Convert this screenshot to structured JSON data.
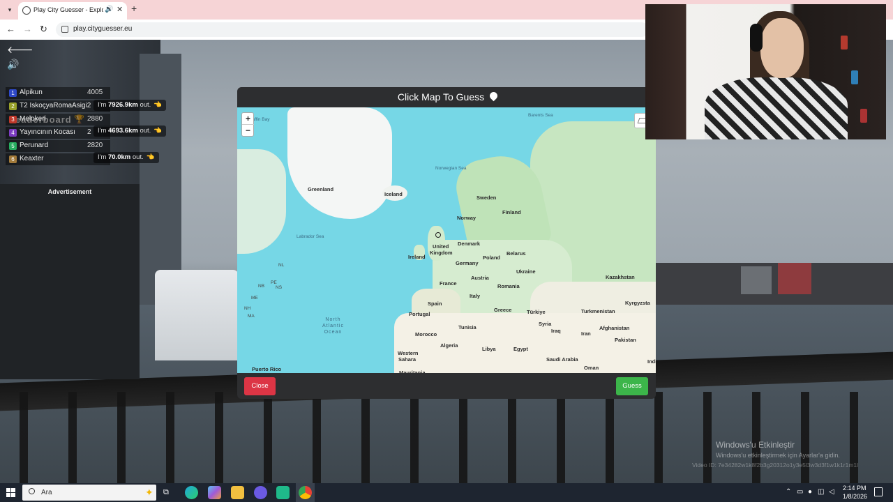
{
  "browser": {
    "tab_title": "Play City Guesser - Explore",
    "url": "play.cityguesser.eu"
  },
  "leaderboard": {
    "title": "Leaderboard",
    "rows": [
      {
        "rank": "1",
        "name": "Alpikun",
        "score": "4005",
        "color": "#2f49c8"
      },
      {
        "rank": "2",
        "name": "T2 İskoçyaRomaAsigi2",
        "score": "",
        "color": "#9aa22a"
      },
      {
        "rank": "3",
        "name": "Melokeri",
        "score": "2880",
        "color": "#c0392b"
      },
      {
        "rank": "4",
        "name": "Yayıncının Kocası",
        "score": "2",
        "color": "#7d3cc2"
      },
      {
        "rank": "5",
        "name": "Perunard",
        "score": "2820",
        "color": "#27ae60"
      },
      {
        "rank": "6",
        "name": "Keaxter",
        "score": "",
        "color": "#a27a3a"
      }
    ],
    "bubbles": [
      {
        "prefix": "I'm",
        "distance": "7926.9km",
        "suffix": "out."
      },
      {
        "prefix": "I'm",
        "distance": "4693.6km",
        "suffix": "out."
      },
      {
        "prefix": "I'm",
        "distance": "70.0km",
        "suffix": "out."
      }
    ]
  },
  "advertisement_label": "Advertisement",
  "modal": {
    "title": "Click Map To Guess",
    "close_label": "Close",
    "guess_label": "Guess",
    "zoom_in": "+",
    "zoom_out": "−"
  },
  "map": {
    "countries": [
      "Greenland",
      "Iceland",
      "Sweden",
      "Finland",
      "Norway",
      "United",
      "Kingdom",
      "Denmark",
      "Ireland",
      "Poland",
      "Belarus",
      "Germany",
      "Ukraine",
      "Austria",
      "France",
      "Romania",
      "Kazakhstan",
      "Italy",
      "Kyrgyzsta",
      "Spain",
      "Greece",
      "Türkiye",
      "Turkmenistan",
      "Portugal",
      "Syria",
      "Tunisia",
      "Afghanistan",
      "Iraq",
      "Iran",
      "Morocco",
      "Pakistan",
      "Algeria",
      "Libya",
      "Egypt",
      "Western",
      "Sahara",
      "Saudi Arabia",
      "Oman",
      "Mauritania",
      "Puerto Rico",
      "Indi"
    ],
    "seas": [
      "Barents Sea",
      "Norwegian Sea",
      "Labrador Sea",
      "Baffin Bay"
    ],
    "ocean_lines": [
      "North",
      "Atlantic",
      "Ocean"
    ],
    "province_codes": [
      "NL",
      "PE",
      "NB",
      "NS",
      "ME",
      "NH",
      "MA"
    ]
  },
  "watermark": {
    "title": "Windows'u Etkinleştir",
    "subtitle": "Windows'u etkinleştirmek için Ayarlar'a gidin.",
    "video_id": "Video ID: 7e34282w1k8f2b3g20312o1y3e5l3w3d3f1w1k1r1m1l"
  },
  "taskbar": {
    "search_placeholder": "Ara",
    "time": "2:14 PM",
    "date": "1/8/2026"
  },
  "colors": {
    "close_button": "#dc3545",
    "guess_button": "#3cb54a",
    "map_water": "#76d7e6",
    "tab_strip": "#f6d4d6"
  }
}
